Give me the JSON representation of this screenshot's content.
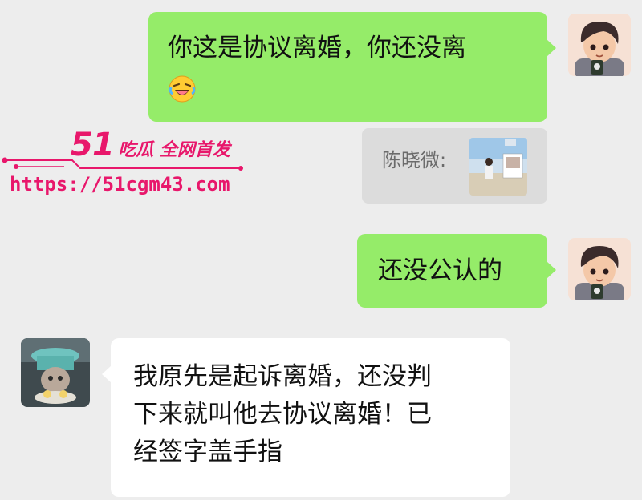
{
  "watermark": {
    "brand_number": "51",
    "brand_text": "吃瓜 全网首发",
    "url": "https://51cgm43.com",
    "color": "#e8176b"
  },
  "messages": [
    {
      "side": "out",
      "text_line1": "你这是协议离婚，你还没离",
      "emoji": "laughing-tears-emoji"
    },
    {
      "side": "quote",
      "sender": "陈晓微:"
    },
    {
      "side": "out",
      "text": "还没公认的"
    },
    {
      "side": "in",
      "lines": [
        "我原先是起诉离婚，还没判",
        "下来就叫他去协议离婚！已",
        "经签字盖手指"
      ]
    }
  ],
  "colors": {
    "background": "#ededed",
    "outgoing_bubble": "#95ec69",
    "incoming_bubble": "#ffffff",
    "quote_bg": "#dcdcdc"
  }
}
